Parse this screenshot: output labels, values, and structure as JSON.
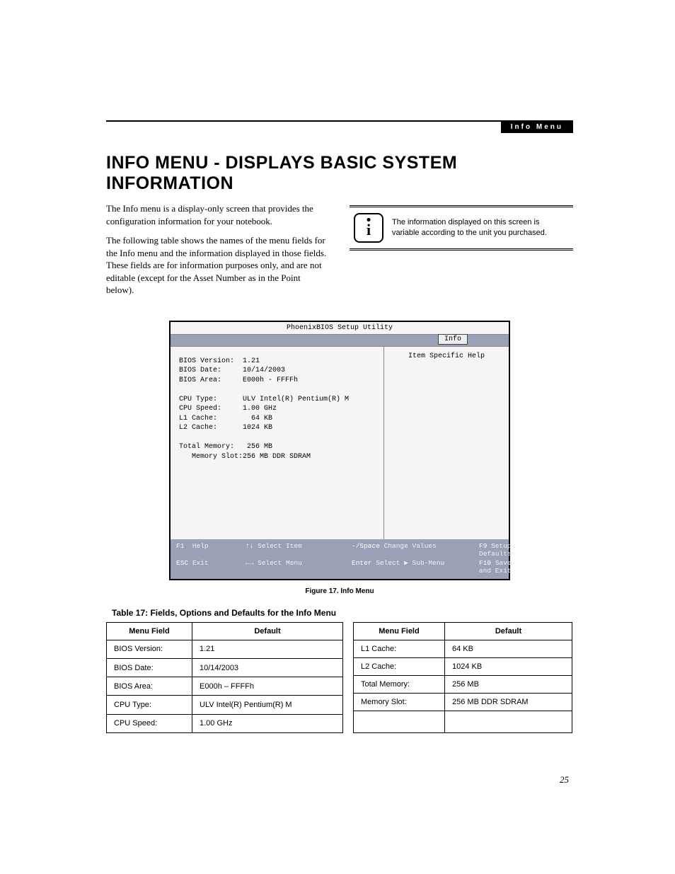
{
  "chapterTag": "Info Menu",
  "heading": "INFO MENU - DISPLAYS BASIC SYSTEM INFORMATION",
  "para1": "The Info menu is a display-only screen that provides the configuration information for your notebook.",
  "para2": "The following table shows the names of the menu fields for the Info menu and the information displayed in those fields. These fields are for information purposes only, and are not editable (except for the Asset Number as in the Point below).",
  "noteText": "The information displayed on this screen is variable according to the unit you purchased.",
  "bios": {
    "title": "PhoenixBIOS Setup Utility",
    "tab": "Info",
    "helpHeader": "Item Specific Help",
    "rows": [
      [
        "BIOS Version:",
        "1.21"
      ],
      [
        "BIOS Date:",
        "10/14/2003"
      ],
      [
        "BIOS Area:",
        "E000h - FFFFh"
      ],
      [
        "",
        ""
      ],
      [
        "CPU Type:",
        "ULV Intel(R) Pentium(R) M"
      ],
      [
        "CPU Speed:",
        "1.00 GHz"
      ],
      [
        "L1 Cache:",
        "  64 KB"
      ],
      [
        "L2 Cache:",
        "1024 KB"
      ],
      [
        "",
        ""
      ],
      [
        "Total Memory:",
        " 256 MB"
      ],
      [
        "   Memory Slot:",
        "256 MB DDR SDRAM"
      ]
    ],
    "footer": {
      "r1": {
        "a": "F1",
        "al": "Help",
        "b": "↑↓",
        "bl": "Select Item",
        "c": "-/Space",
        "cl": "Change Values",
        "d": "F9",
        "dl": "Setup Defaults"
      },
      "r2": {
        "a": "ESC",
        "al": "Exit",
        "b": "←→",
        "bl": "Select Menu",
        "c": "Enter",
        "cl": "Select ▶ Sub-Menu",
        "d": "F10",
        "dl": "Save and Exit"
      }
    }
  },
  "figCaption": "Figure 17.  Info Menu",
  "tableTitle": "Table 17: Fields, Options and Defaults for the Info Menu",
  "th": {
    "field": "Menu Field",
    "default": "Default"
  },
  "leftRows": [
    [
      "BIOS Version:",
      "1.21"
    ],
    [
      "BIOS Date:",
      "10/14/2003"
    ],
    [
      "BIOS Area:",
      "E000h – FFFFh"
    ],
    [
      "CPU Type:",
      "ULV Intel(R) Pentium(R) M"
    ],
    [
      "CPU Speed:",
      "1.00 GHz"
    ]
  ],
  "rightRows": [
    [
      "L1 Cache:",
      "64 KB"
    ],
    [
      "L2 Cache:",
      "1024 KB"
    ],
    [
      "Total Memory:",
      "256 MB"
    ],
    [
      "Memory Slot:",
      "256 MB DDR SDRAM"
    ]
  ],
  "pageNumber": "25"
}
